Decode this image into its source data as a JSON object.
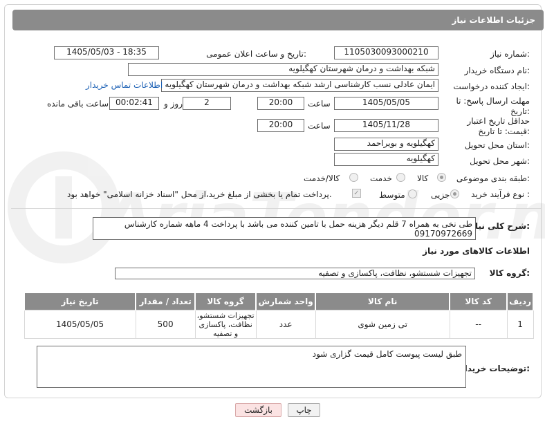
{
  "header": {
    "title": "جزئیات اطلاعات نیاز"
  },
  "fields": {
    "need_number_label": "شماره نیاز:",
    "need_number": "1105030093000210",
    "announce_label": "تاریخ و ساعت اعلان عمومی:",
    "announce_value": "1405/05/03 - 18:35",
    "buyer_org_label": "نام دستگاه خریدار:",
    "buyer_org": "شبکه بهداشت و درمان شهرستان کهگیلویه",
    "creator_label": "ایجاد کننده درخواست:",
    "creator": "ایمان عادلی نسب کارشناسی ارشد شبکه بهداشت و درمان شهرستان کهگیلویه",
    "contact_link": "اطلاعات تماس خریدار",
    "deadline_label": "مهلت ارسال پاسخ: تا تاریخ:",
    "deadline_date": "1405/05/05",
    "time_label": "ساعت",
    "deadline_time": "20:00",
    "days_value": "2",
    "days_label": "روز و",
    "remaining_time": "00:02:41",
    "remaining_label": "ساعت باقی مانده",
    "validity_label": "حداقل تاریخ اعتبار قیمت: تا تاریخ:",
    "validity_date": "1405/11/28",
    "validity_time": "20:00",
    "province_label": "استان محل تحویل:",
    "province": "کهگیلویه و بویراحمد",
    "city_label": "شهر محل تحویل:",
    "city": "کهگیلویه",
    "category_label": "طبقه بندی موضوعی:",
    "category_options": [
      "کالا",
      "خدمت",
      "کالا/خدمت"
    ],
    "process_label": "نوع فرآیند خرید :",
    "process_options": [
      "جزیی",
      "متوسط"
    ],
    "payment_note": "پرداخت تمام یا بخشی از مبلغ خرید،از محل \"اسناد خزانه اسلامی\" خواهد بود."
  },
  "description": {
    "label": "شرح کلی نیاز:",
    "text": "طی نخی  به همراه 7  قلم دیگر هزینه حمل با تامین کننده می باشد با پرداخت 4 ماهه  شماره کارشناس 09170972669"
  },
  "goods": {
    "section_title": "اطلاعات کالاهای مورد نیاز",
    "group_label": "گروه کالا:",
    "group_value": "تجهیزات شستشو، نظافت، پاکسازی و تصفیه",
    "columns": [
      "ردیف",
      "کد کالا",
      "نام کالا",
      "واحد شمارش",
      "گروه کالا",
      "تعداد / مقدار",
      "تاریخ نیاز"
    ],
    "rows": [
      [
        "1",
        "--",
        "تی زمین شوی",
        "عدد",
        "تجهیزات شستشو، نظافت، پاکسازی و تصفیه",
        "500",
        "1405/05/05"
      ]
    ]
  },
  "buyer_notes": {
    "label": "توضیحات خریدار:",
    "text": "طبق لیست پیوست کامل قیمت گزاری شود"
  },
  "buttons": {
    "print": "چاپ",
    "back": "بازگشت"
  },
  "colors": {
    "header_bg": "#8b8b8b",
    "link": "#1a5fb4",
    "back_button_bg": "#fbe3e3"
  }
}
